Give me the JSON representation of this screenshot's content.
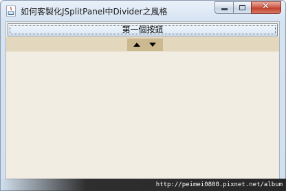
{
  "window": {
    "title": "如何客製化JSplitPanel中Divider之風格",
    "app_icon": "java-cup-icon",
    "controls": {
      "minimize_icon": "minimize-icon",
      "maximize_icon": "maximize-icon",
      "close_icon": "close-icon",
      "close_glyph": "✕"
    }
  },
  "split_pane": {
    "top_button_label": "第一個按鈕",
    "divider": {
      "one_touch_expand": true,
      "up_arrow_icon": "arrow-up-icon",
      "down_arrow_icon": "arrow-down-icon",
      "color": "#e3d8bd",
      "arrows_background": "#ccb98f"
    },
    "pane_background": "#f2ede3"
  },
  "watermark": {
    "text": "http://peimei0808.pixnet.net/album"
  }
}
